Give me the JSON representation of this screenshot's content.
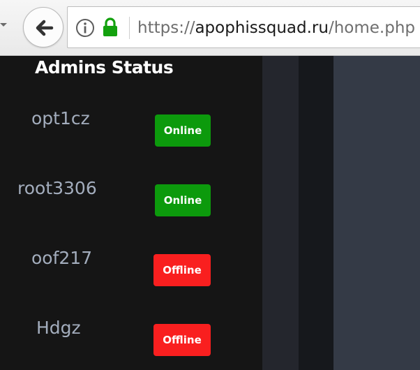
{
  "browser": {
    "url_scheme": "https://",
    "url_host": "apophissquad.ru",
    "url_path": "/home.php"
  },
  "panel": {
    "title": "Admins Status",
    "admins": [
      {
        "name": "opt1cz",
        "status": "Online"
      },
      {
        "name": "root3306",
        "status": "Online"
      },
      {
        "name": "oof217",
        "status": "Offline"
      },
      {
        "name": "Hdgz",
        "status": "Offline"
      }
    ]
  },
  "colors": {
    "online": "#0c9a0c",
    "offline": "#f91f1f"
  }
}
